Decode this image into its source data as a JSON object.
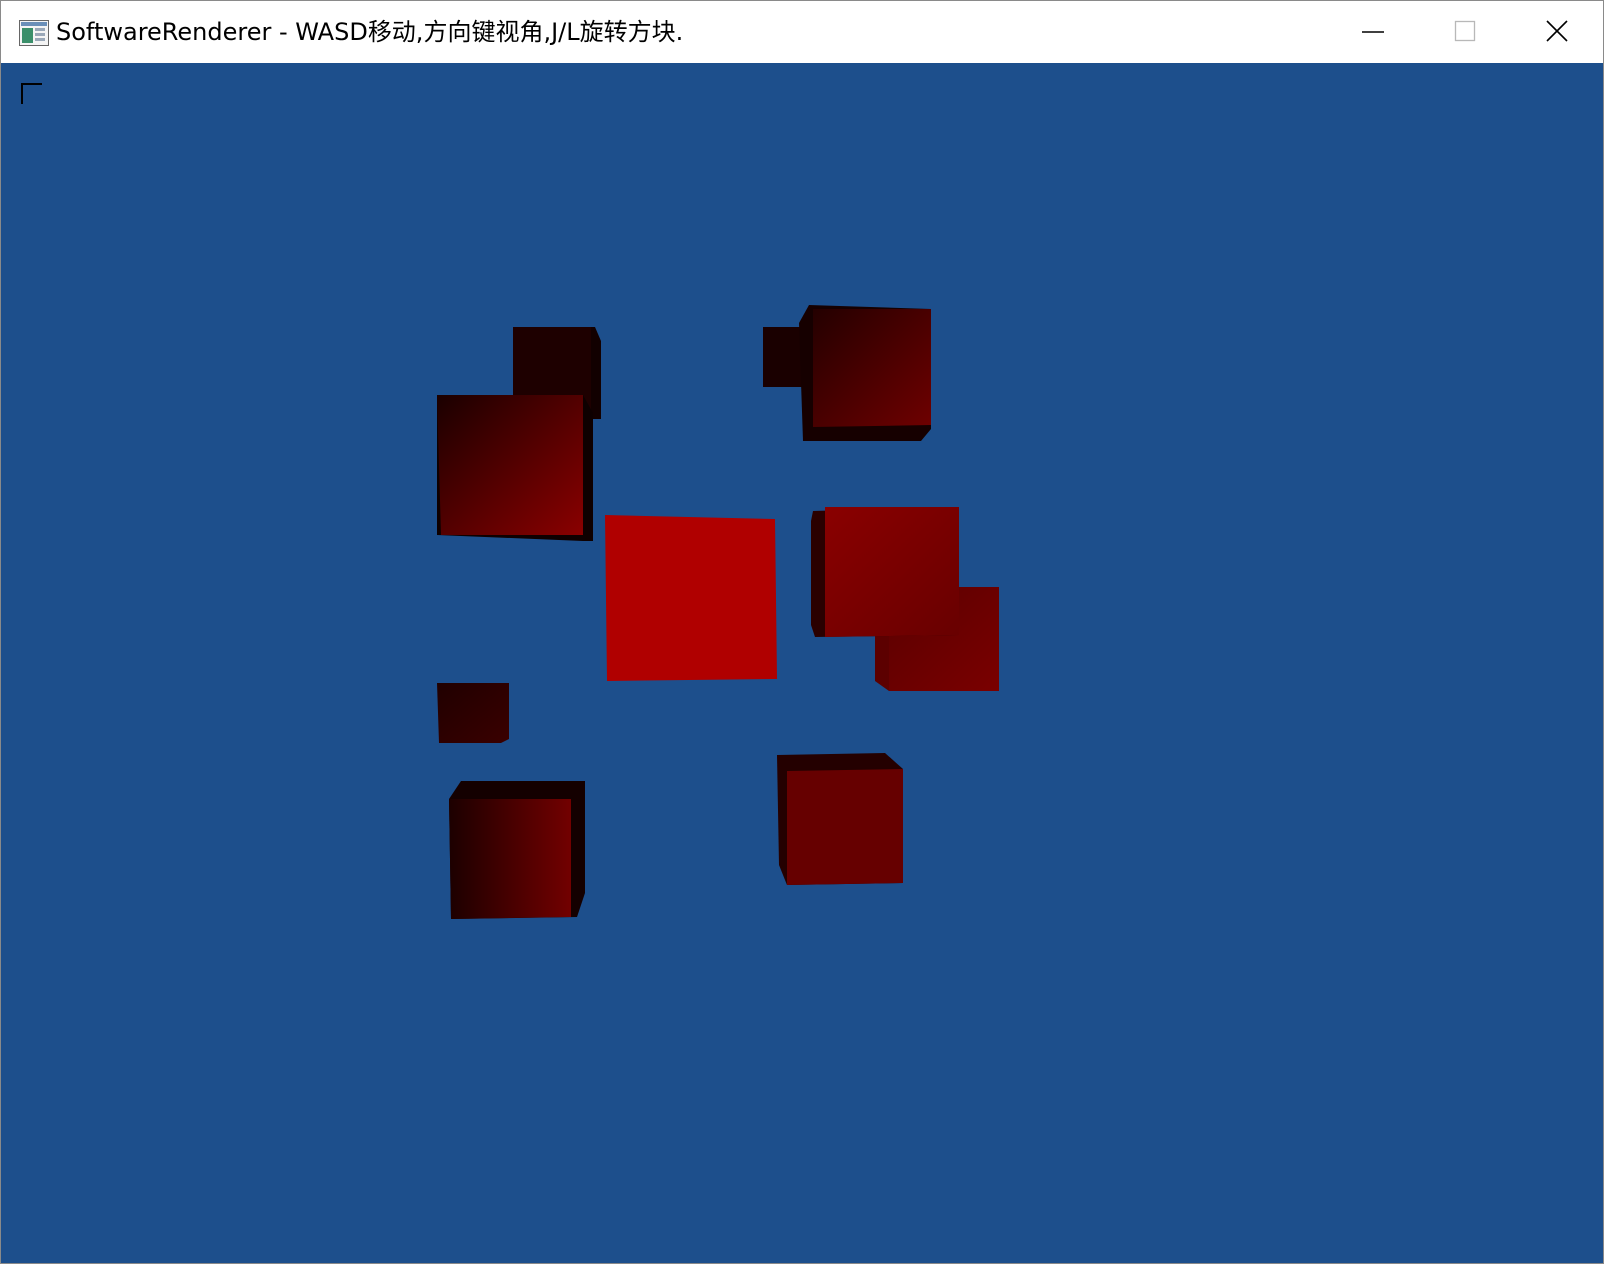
{
  "window": {
    "title": "SoftwareRenderer - WASD移动,方向键视角,J/L旋转方块.",
    "icon": "app-window-icon",
    "controls": {
      "minimize_icon": "minimize-icon",
      "maximize_icon": "maximize-icon",
      "close_icon": "close-icon"
    }
  },
  "scene": {
    "background_color": "#1d4f8c",
    "cube_color": "#b00000",
    "cube_shadow_color": "#1a0000",
    "corner_marker_icon": "corner-bracket-icon",
    "cube_count": 10
  }
}
